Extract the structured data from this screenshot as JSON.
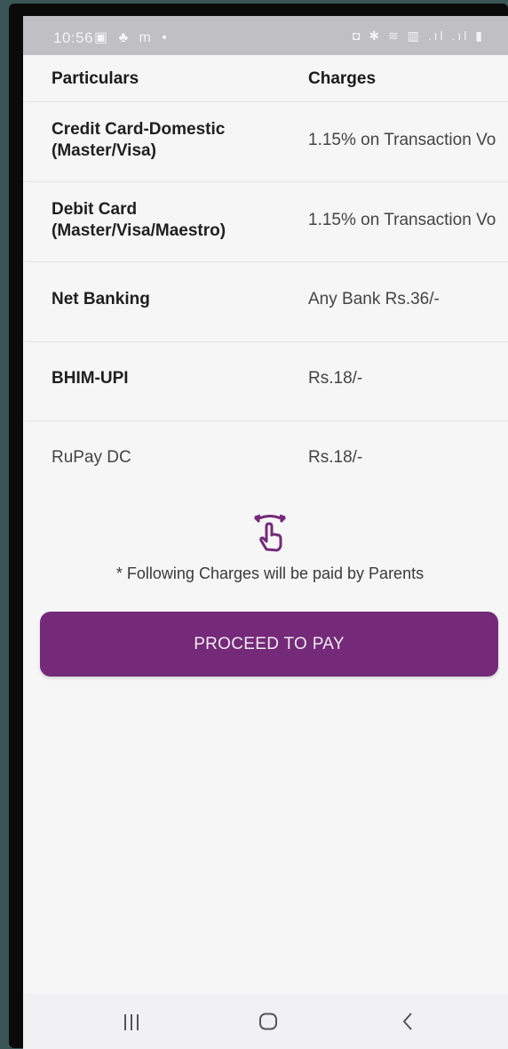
{
  "status_bar": {
    "time": "10:56",
    "left_icons": "▣ ♣ m •",
    "right_icons": "◘ ✱ ≋ ▥ .ıl .ıl ▮"
  },
  "table": {
    "headers": {
      "particulars": "Particulars",
      "charges": "Charges"
    },
    "rows": [
      {
        "particular": "Credit Card-Domestic (Master/Visa)",
        "charge": "1.15% on Transaction Vo"
      },
      {
        "particular": "Debit Card (Master/Visa/Maestro)",
        "charge": "1.15% on Transaction Vo"
      },
      {
        "particular": "Net Banking",
        "charge": "Any Bank Rs.36/-"
      },
      {
        "particular": "BHIM-UPI",
        "charge": "Rs.18/-"
      },
      {
        "particular": "RuPay DC",
        "charge": "Rs.18/-"
      }
    ]
  },
  "note": "* Following Charges will be paid by Parents",
  "proceed_button": "PROCEED TO PAY",
  "colors": {
    "accent": "#742a78",
    "background": "#f6f6f7"
  },
  "icons": {
    "swipe": "swipe-horizontal-icon",
    "nav_recent": "recent-apps-icon",
    "nav_home": "home-icon",
    "nav_back": "back-icon"
  }
}
